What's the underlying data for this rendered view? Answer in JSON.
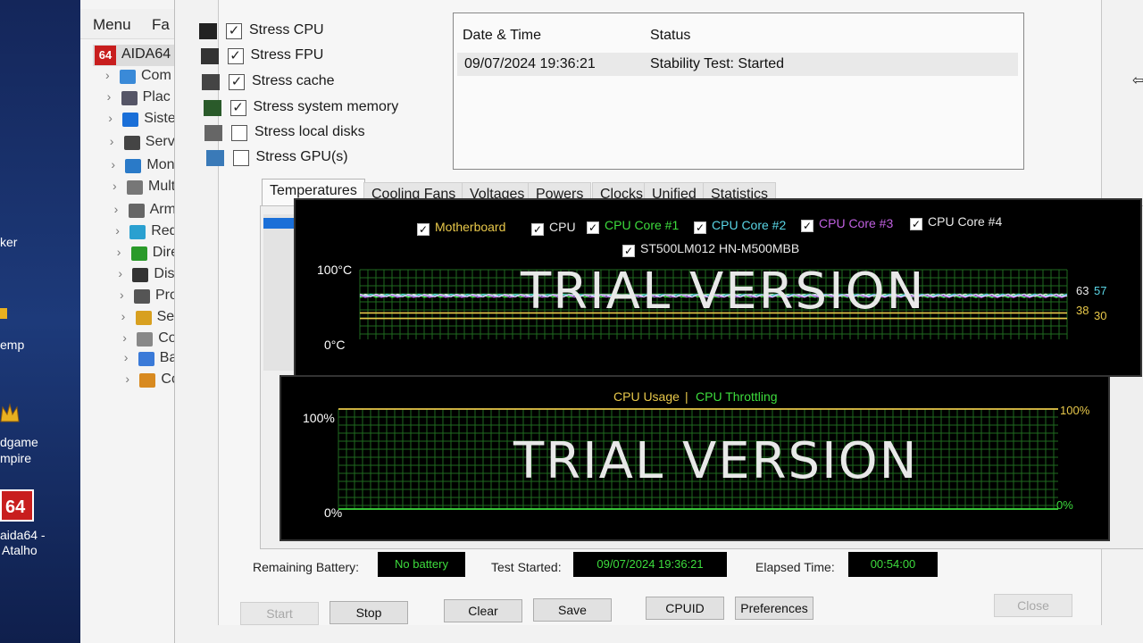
{
  "desktop": {
    "labels": [
      "ker",
      "emp",
      "dgame",
      "mpire",
      "aida64 -",
      "Atalho"
    ]
  },
  "bg_window": {
    "menu": [
      "Menu",
      "Fa"
    ],
    "root_label": "AIDA64",
    "root_badge": "64",
    "tree": [
      {
        "label": "Com",
        "icon": "computer-icon"
      },
      {
        "label": "Plac",
        "icon": "motherboard-icon"
      },
      {
        "label": "Siste",
        "icon": "windows-icon"
      },
      {
        "label": "Servi",
        "icon": "server-icon"
      },
      {
        "label": "Mon",
        "icon": "monitor-icon"
      },
      {
        "label": "Mult",
        "icon": "speaker-icon"
      },
      {
        "label": "Arm",
        "icon": "storage-icon"
      },
      {
        "label": "Rede",
        "icon": "network-icon"
      },
      {
        "label": "Direc",
        "icon": "xbox-icon"
      },
      {
        "label": "Disp",
        "icon": "device-icon"
      },
      {
        "label": "Prog",
        "icon": "programs-icon"
      },
      {
        "label": "Segu",
        "icon": "shield-icon"
      },
      {
        "label": "Con",
        "icon": "config-icon"
      },
      {
        "label": "Banc",
        "icon": "database-icon"
      },
      {
        "label": "Com",
        "icon": "benchmark-icon"
      }
    ]
  },
  "stress": [
    {
      "label": "Stress CPU",
      "checked": true,
      "icon": "cpu-icon"
    },
    {
      "label": "Stress FPU",
      "checked": true,
      "icon": "fpu-icon"
    },
    {
      "label": "Stress cache",
      "checked": true,
      "icon": "cache-icon"
    },
    {
      "label": "Stress system memory",
      "checked": true,
      "icon": "memory-icon"
    },
    {
      "label": "Stress local disks",
      "checked": false,
      "icon": "disk-icon"
    },
    {
      "label": "Stress GPU(s)",
      "checked": false,
      "icon": "gpu-icon"
    }
  ],
  "log": {
    "col_date": "Date & Time",
    "col_status": "Status",
    "rows": [
      {
        "date": "09/07/2024 19:36:21",
        "status": "Stability Test: Started"
      }
    ]
  },
  "tabs": [
    "Temperatures",
    "Cooling Fans",
    "Voltages",
    "Powers",
    "Clocks",
    "Unified",
    "Statistics"
  ],
  "temp_graph": {
    "legend": [
      {
        "label": "Motherboard",
        "color": "#e8c84a"
      },
      {
        "label": "CPU",
        "color": "#e8e8e8"
      },
      {
        "label": "CPU Core #1",
        "color": "#3ddc3d"
      },
      {
        "label": "CPU Core #2",
        "color": "#5ad6e6"
      },
      {
        "label": "CPU Core #3",
        "color": "#c060e0"
      },
      {
        "label": "CPU Core #4",
        "color": "#e8e8e8"
      },
      {
        "label": "ST500LM012 HN-M500MBB",
        "color": "#e8e8e8"
      }
    ],
    "y_max": "100°C",
    "y_min": "0°C",
    "values": {
      "v63": "63",
      "v57": "57",
      "v38": "38",
      "v30": "30"
    },
    "watermark": "TRIAL VERSION"
  },
  "cpu_graph": {
    "title_usage": "CPU Usage",
    "separator": "|",
    "title_throttle": "CPU Throttling",
    "y_max_left": "100%",
    "y_min_left": "0%",
    "y_max_right": "100%",
    "y_min_right": "0%",
    "watermark": "TRIAL VERSION"
  },
  "chart_data": [
    {
      "type": "line",
      "title": "",
      "ylim": [
        0,
        100
      ],
      "ylabel": "°C",
      "series": [
        {
          "name": "Motherboard",
          "values": [
            38
          ]
        },
        {
          "name": "CPU",
          "values": [
            63
          ]
        },
        {
          "name": "CPU Core #1",
          "values": [
            62
          ]
        },
        {
          "name": "CPU Core #2",
          "values": [
            63
          ]
        },
        {
          "name": "CPU Core #3",
          "values": [
            62
          ]
        },
        {
          "name": "CPU Core #4",
          "values": [
            63
          ]
        },
        {
          "name": "ST500LM012 HN-M500MBB",
          "values": [
            30
          ]
        }
      ],
      "grid": true
    },
    {
      "type": "line",
      "title": "CPU Usage | CPU Throttling",
      "ylim": [
        0,
        100
      ],
      "series": [
        {
          "name": "CPU Usage",
          "values": [
            100
          ]
        },
        {
          "name": "CPU Throttling",
          "values": [
            0
          ]
        }
      ],
      "grid": true
    }
  ],
  "status": {
    "battery_label": "Remaining Battery:",
    "battery_value": "No battery",
    "started_label": "Test Started:",
    "started_value": "09/07/2024 19:36:21",
    "elapsed_label": "Elapsed Time:",
    "elapsed_value": "00:54:00"
  },
  "buttons": {
    "start": "Start",
    "stop": "Stop",
    "clear": "Clear",
    "save": "Save",
    "cpuid": "CPUID",
    "preferences": "Preferences",
    "close": "Close"
  }
}
